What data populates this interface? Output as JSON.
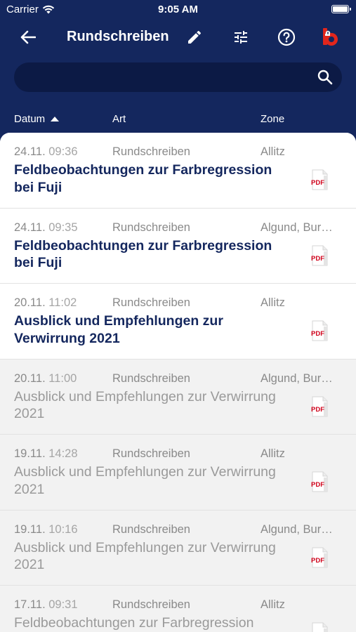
{
  "status_bar": {
    "carrier": "Carrier",
    "time": "9:05 AM"
  },
  "nav": {
    "title": "Rundschreiben"
  },
  "search": {
    "value": "",
    "placeholder": ""
  },
  "columns": {
    "date": "Datum",
    "type": "Art",
    "zone": "Zone"
  },
  "pdf_label": "PDF",
  "colors": {
    "header_bg": "#14275e",
    "unread_title": "#14275e",
    "pdf_red": "#d0021b",
    "read_bg": "#f2f2f2"
  },
  "rows": [
    {
      "date": "24.11.",
      "time": "09:36",
      "type": "Rundschreiben",
      "zone": "Allitz",
      "subject": "Feldbeobachtungen zur Farbregression bei Fuji",
      "read": false
    },
    {
      "date": "24.11.",
      "time": "09:35",
      "type": "Rundschreiben",
      "zone": "Algund, Bur…",
      "subject": "Feldbeobachtungen zur Farbregression bei Fuji",
      "read": false
    },
    {
      "date": "20.11.",
      "time": "11:02",
      "type": "Rundschreiben",
      "zone": "Allitz",
      "subject": "Ausblick und Empfehlungen zur Verwirrung 2021",
      "read": false
    },
    {
      "date": "20.11.",
      "time": "11:00",
      "type": "Rundschreiben",
      "zone": "Algund, Bur…",
      "subject": "Ausblick und Empfehlungen zur Verwirrung 2021",
      "read": true
    },
    {
      "date": "19.11.",
      "time": "14:28",
      "type": "Rundschreiben",
      "zone": "Allitz",
      "subject": "Ausblick und Empfehlungen zur Verwirrung 2021",
      "read": true
    },
    {
      "date": "19.11.",
      "time": "10:16",
      "type": "Rundschreiben",
      "zone": "Algund, Bur…",
      "subject": "Ausblick und Empfehlungen zur Verwirrung 2021",
      "read": true
    },
    {
      "date": "17.11.",
      "time": "09:31",
      "type": "Rundschreiben",
      "zone": "Allitz",
      "subject": "Feldbeobachtungen zur Farbregression",
      "read": true
    }
  ]
}
